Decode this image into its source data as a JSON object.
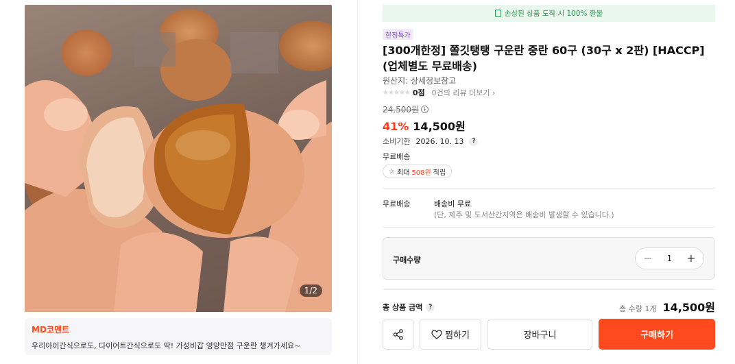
{
  "product_image": {
    "counter": "1/2"
  },
  "md_comment": {
    "title": "MD코멘트",
    "text": "우리아이간식으로도, 다이어트간식으로도 딱! 가성비갑 영양만점 구운란 챙겨가세요~"
  },
  "refund_banner": {
    "text": "손상된 상품 도착 시 100% 환불",
    "icon": "battery-shield-icon"
  },
  "promo_badge": "한정특가",
  "title": "[300개한정] 쫄깃탱탱 구운란 중란 60구 (30구 x 2판) [HACCP] (업체별도 무료배송)",
  "origin": "원산지: 상세정보참고",
  "rating": {
    "stars": "★★★★★",
    "score": "0점",
    "reviews_link": "0건의 리뷰 더보기",
    "chevron": "›"
  },
  "price": {
    "original": "24,500원",
    "info_icon": "i",
    "discount": "41%",
    "sale": "14,500원"
  },
  "expiry": {
    "label": "소비기한",
    "value": "2026. 10. 13",
    "help": "?"
  },
  "free_shipping": "무료배송",
  "points": {
    "prefix": "최대",
    "amount": "508원",
    "suffix": "적립"
  },
  "shipping": {
    "label": "무료배송",
    "fee": "배송비 무료",
    "note": "(단, 제주 및 도서산간지역은 배송비 발생할 수 있습니다.)"
  },
  "quantity": {
    "label": "구매수량",
    "minus": "−",
    "value": "1",
    "plus": "+"
  },
  "total": {
    "label": "총 상품 금액",
    "help": "?",
    "qty_text": "총 수량 1개",
    "price": "14,500원"
  },
  "actions": {
    "wish": "찜하기",
    "cart": "장바구니",
    "buy": "구매하기"
  },
  "colors": {
    "accent": "#ff4a1f",
    "refund_green": "#2a9a4f",
    "promo_purple": "#7b4bc7"
  }
}
